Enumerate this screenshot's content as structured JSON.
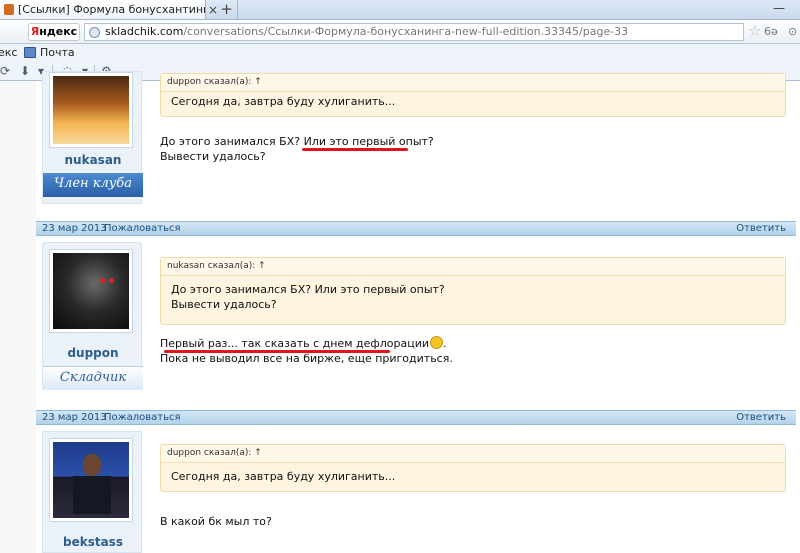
{
  "browser": {
    "tab_title": "[Ссылки] Формула бонусхантинга Ne...",
    "tab_close": "×",
    "tab_new": "+",
    "window_min": "—",
    "yandex_first": "Я",
    "yandex_rest": "ндекс",
    "url_host": "skladchik.com",
    "url_path": "/conversations/Ссылки-Формула-бонусханинга-new-full-edition.33345/page-33",
    "star_icon": "☆",
    "reader_icon": "6ə",
    "right_icon": "⊙"
  },
  "bookmarks": {
    "item1": "екс",
    "mail": "Почта"
  },
  "messages": [
    {
      "username": "nukasan",
      "rank": "Член клуба",
      "quote_author": "duppon сказал(а): ↑",
      "quote_text": "Сегодня да, завтра буду хулиганить...",
      "line1": "До этого занимался БХ? Или это первый опыт?",
      "line2": "Вывести удалось?"
    },
    {
      "date": "23 мар 2013",
      "report": "Пожаловаться",
      "reply": "Ответить",
      "username": "duppon",
      "rank": "Складчик",
      "quote_author": "nukasan сказал(а): ↑",
      "quote_line1": "До этого занимался БХ? Или это первый опыт?",
      "quote_line2": "Вывести удалось?",
      "line1": "Первый раз... так сказать с днем дефлорации",
      "line1_end": ".",
      "line2": "Пока не выводил все на бирже, еще пригодиться."
    },
    {
      "date": "23 мар 2013",
      "report": "Пожаловаться",
      "reply": "Ответить",
      "username": "bekstass",
      "quote_author": "duppon сказал(а): ↑",
      "quote_text": "Сегодня да, завтра буду хулиганить...",
      "line1": "В какой бк мыл то?"
    }
  ],
  "colors": {
    "header_bg": "#b3d2ea",
    "rank_blue": "#3a73b5",
    "underline_red": "#e2141b"
  }
}
